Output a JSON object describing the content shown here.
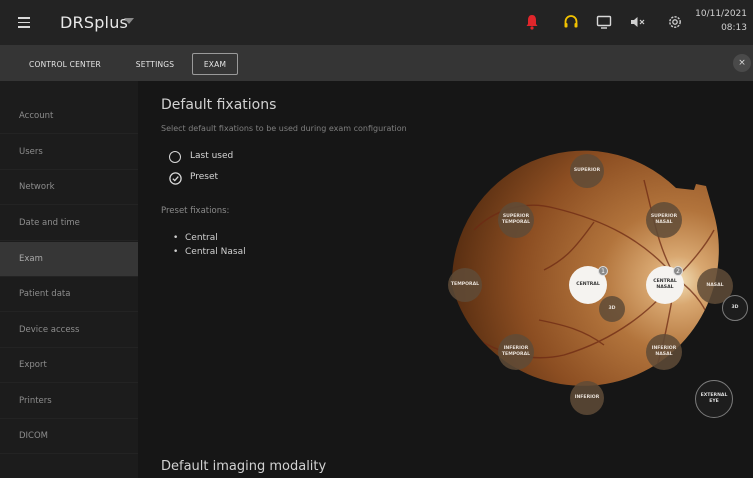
{
  "header": {
    "app_title": "DRSplus",
    "date": "10/11/2021",
    "time": "08:13",
    "icons": [
      "alarm-bell-icon",
      "headset-icon",
      "monitor-icon",
      "mute-icon",
      "settings-gear-icon"
    ],
    "alert_color": "#e0262b",
    "headset_color": "#f2c200"
  },
  "tabs": [
    {
      "label": "CONTROL CENTER",
      "active": false
    },
    {
      "label": "SETTINGS",
      "active": false
    },
    {
      "label": "EXAM",
      "active": true
    }
  ],
  "close_label": "×",
  "sidebar": {
    "items": [
      {
        "label": "Account"
      },
      {
        "label": "Users"
      },
      {
        "label": "Network"
      },
      {
        "label": "Date and time"
      },
      {
        "label": "Exam",
        "selected": true
      },
      {
        "label": "Patient data"
      },
      {
        "label": "Device access"
      },
      {
        "label": "Export"
      },
      {
        "label": "Printers"
      },
      {
        "label": "DICOM"
      }
    ]
  },
  "main": {
    "title": "Default fixations",
    "subtitle": "Select default fixations to be used during exam configuration",
    "options": [
      {
        "label": "Last used",
        "checked": false
      },
      {
        "label": "Preset",
        "checked": true
      }
    ],
    "preset_heading": "Preset fixations:",
    "preset_list": [
      "Central",
      "Central Nasal"
    ],
    "next_section_title": "Default imaging modality"
  },
  "fixations": {
    "superior": "SUPERIOR",
    "superior_temporal": [
      "SUPERIOR",
      "TEMPORAL"
    ],
    "superior_nasal": [
      "SUPERIOR",
      "NASAL"
    ],
    "temporal": "TEMPORAL",
    "central": "CENTRAL",
    "central_badge": "1",
    "central_nasal": [
      "CENTRAL",
      "NASAL"
    ],
    "central_nasal_badge": "2",
    "nasal": "NASAL",
    "central_3d": "3D",
    "nasal_3d": "3D",
    "inferior_temporal": [
      "INFERIOR",
      "TEMPORAL"
    ],
    "inferior_nasal": [
      "INFERIOR",
      "NASAL"
    ],
    "inferior": "INFERIOR",
    "external_eye": [
      "EXTERNAL",
      "EYE"
    ]
  }
}
